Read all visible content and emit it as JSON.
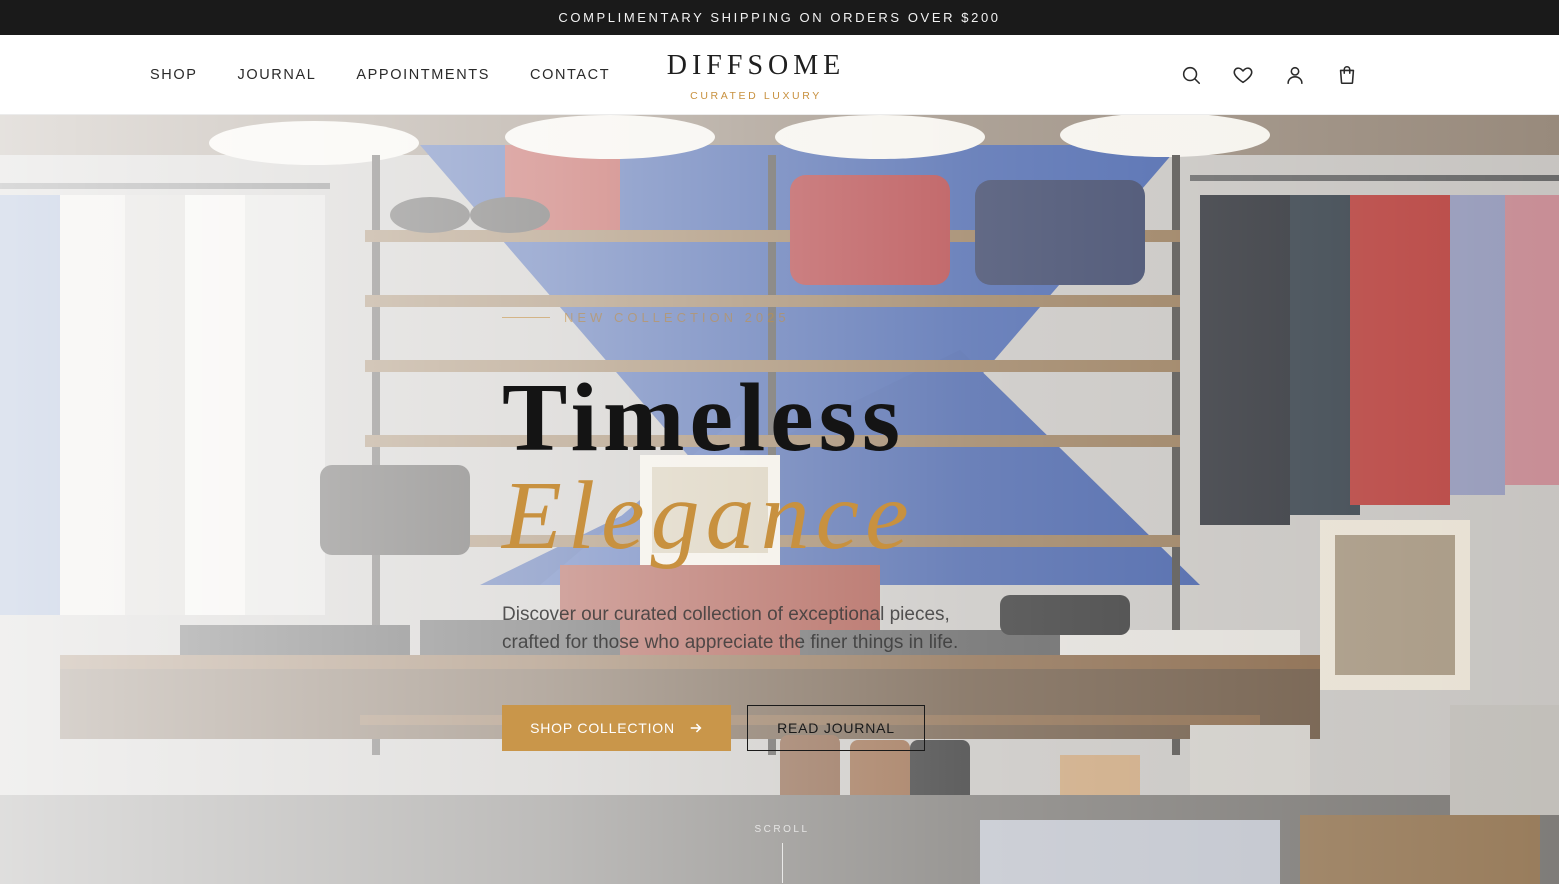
{
  "announcement": "COMPLIMENTARY SHIPPING ON ORDERS OVER $200",
  "nav": {
    "items": [
      {
        "label": "SHOP"
      },
      {
        "label": "JOURNAL"
      },
      {
        "label": "APPOINTMENTS"
      },
      {
        "label": "CONTACT"
      }
    ]
  },
  "brand": {
    "name": "DIFFSOME",
    "tagline": "CURATED LUXURY"
  },
  "header_icons": [
    "search-icon",
    "heart-icon",
    "user-icon",
    "shopping-bag-icon"
  ],
  "hero": {
    "eyebrow": "NEW COLLECTION 2025",
    "title_line1": "Timeless",
    "title_line2": "Elegance",
    "subtitle_line1": "Discover our curated collection of exceptional pieces,",
    "subtitle_line2": "crafted for those who appreciate the finer things in life.",
    "primary_cta": "SHOP COLLECTION",
    "secondary_cta": "READ JOURNAL",
    "scroll_label": "SCROLL",
    "image_alt": "Clothing store interior with garment racks, shelves of bags and shoes"
  },
  "colors": {
    "accent": "#c9964a",
    "announcement_bg": "#1a1a1a",
    "text": "#1a1a1a"
  }
}
